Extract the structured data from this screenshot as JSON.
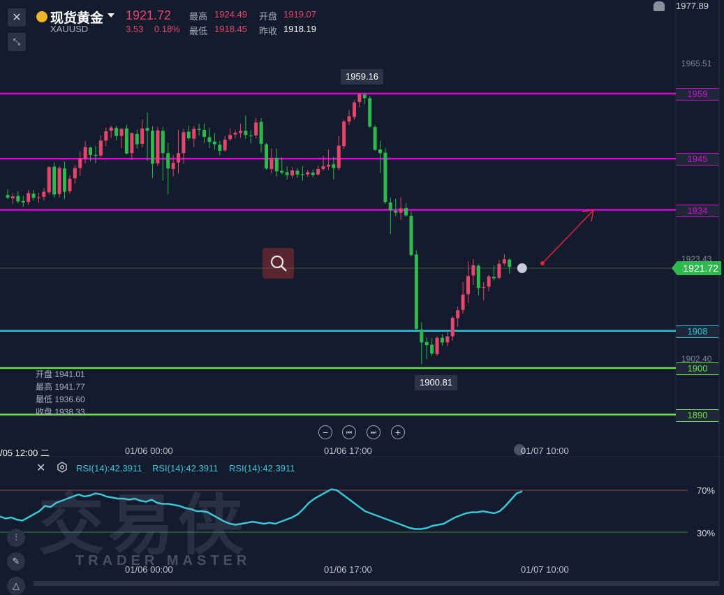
{
  "header": {
    "symbol_name": "现货黄金",
    "symbol_code": "XAUUSD",
    "last_price": "1921.72",
    "change": "3.53",
    "change_pct": "0.18%",
    "high_label": "最高",
    "high_value": "1924.49",
    "open_label": "开盘",
    "open_value": "1919.07",
    "low_label": "最低",
    "low_value": "1918.45",
    "prev_close_label": "昨收",
    "prev_close_value": "1918.19"
  },
  "price_axis": {
    "top_value": "1977.89",
    "max_value": "1965.51",
    "current_marker": "1923.43",
    "current_price": "1921.72",
    "min_value": "1902.40"
  },
  "levels": [
    {
      "label": "1959",
      "price": 1959,
      "color": "#d10fd1"
    },
    {
      "label": "1945",
      "price": 1945,
      "color": "#d10fd1"
    },
    {
      "label": "1934",
      "price": 1934,
      "color": "#d10fd1"
    },
    {
      "label": "1908",
      "price": 1908,
      "color": "#26c6d6"
    },
    {
      "label": "1900",
      "price": 1900,
      "color": "#6be04a"
    },
    {
      "label": "1890",
      "price": 1890,
      "color": "#6be04a"
    }
  ],
  "callouts": {
    "high": "1959.16",
    "low": "1900.81"
  },
  "ohlc_panel": {
    "open": "开盘 1941.01",
    "high": "最高 1941.77",
    "low": "最低 1936.60",
    "close": "收盘 1938.33"
  },
  "time_axis": {
    "labels": [
      "/05 12:00 二",
      "01/06 00:00",
      "01/06 17:00",
      "01/07 10:00"
    ]
  },
  "rsi": {
    "labels": [
      "RSI(14):42.3911",
      "RSI(14):42.3911",
      "RSI(14):42.3911"
    ],
    "upper": "70%",
    "lower": "30%",
    "time_labels": [
      "01/06 00:00",
      "01/06 17:00",
      "01/07 10:00"
    ]
  },
  "watermark": {
    "cn": "交易侠",
    "en": "TRADER MASTER"
  },
  "colors": {
    "up": "#e8456d",
    "down": "#2fb84e",
    "rsi_line": "#35c8d8",
    "arrow": "#e0243a"
  },
  "chart_data": {
    "type": "candlestick",
    "symbol": "XAUUSD",
    "y_range": [
      1890,
      1965.51
    ],
    "candles": [
      {
        "o": 1937.2,
        "h": 1938.4,
        "l": 1936.3,
        "c": 1936.6
      },
      {
        "o": 1936.5,
        "h": 1937.6,
        "l": 1935.2,
        "c": 1936.9
      },
      {
        "o": 1937.0,
        "h": 1938.0,
        "l": 1935.4,
        "c": 1935.8
      },
      {
        "o": 1935.9,
        "h": 1937.0,
        "l": 1934.7,
        "c": 1935.6
      },
      {
        "o": 1935.7,
        "h": 1938.3,
        "l": 1935.1,
        "c": 1937.6
      },
      {
        "o": 1937.5,
        "h": 1938.3,
        "l": 1936.0,
        "c": 1936.6
      },
      {
        "o": 1936.6,
        "h": 1937.7,
        "l": 1935.5,
        "c": 1936.7
      },
      {
        "o": 1936.8,
        "h": 1938.7,
        "l": 1936.0,
        "c": 1937.9
      },
      {
        "o": 1937.8,
        "h": 1943.4,
        "l": 1937.4,
        "c": 1943.2
      },
      {
        "o": 1943.3,
        "h": 1944.2,
        "l": 1936.6,
        "c": 1937.3
      },
      {
        "o": 1937.4,
        "h": 1943.4,
        "l": 1936.7,
        "c": 1943.0
      },
      {
        "o": 1942.9,
        "h": 1944.4,
        "l": 1936.3,
        "c": 1937.9
      },
      {
        "o": 1938.0,
        "h": 1941.4,
        "l": 1937.5,
        "c": 1940.7
      },
      {
        "o": 1940.8,
        "h": 1943.7,
        "l": 1939.6,
        "c": 1943.0
      },
      {
        "o": 1943.0,
        "h": 1946.6,
        "l": 1941.3,
        "c": 1945.1
      },
      {
        "o": 1945.0,
        "h": 1948.8,
        "l": 1944.0,
        "c": 1947.5
      },
      {
        "o": 1947.4,
        "h": 1947.6,
        "l": 1944.5,
        "c": 1945.8
      },
      {
        "o": 1945.8,
        "h": 1947.7,
        "l": 1944.0,
        "c": 1945.6
      },
      {
        "o": 1945.7,
        "h": 1950.0,
        "l": 1945.3,
        "c": 1948.9
      },
      {
        "o": 1948.9,
        "h": 1951.7,
        "l": 1947.7,
        "c": 1950.9
      },
      {
        "o": 1951.0,
        "h": 1952.1,
        "l": 1949.5,
        "c": 1951.7
      },
      {
        "o": 1951.6,
        "h": 1952.1,
        "l": 1949.0,
        "c": 1949.9
      },
      {
        "o": 1949.9,
        "h": 1951.6,
        "l": 1947.3,
        "c": 1951.4
      },
      {
        "o": 1951.5,
        "h": 1952.3,
        "l": 1945.9,
        "c": 1946.1
      },
      {
        "o": 1946.2,
        "h": 1950.6,
        "l": 1944.8,
        "c": 1950.5
      },
      {
        "o": 1950.3,
        "h": 1951.2,
        "l": 1947.2,
        "c": 1948.1
      },
      {
        "o": 1948.2,
        "h": 1953.4,
        "l": 1947.4,
        "c": 1951.5
      },
      {
        "o": 1951.6,
        "h": 1955.0,
        "l": 1944.5,
        "c": 1951.0
      },
      {
        "o": 1951.0,
        "h": 1952.0,
        "l": 1940.9,
        "c": 1943.9
      },
      {
        "o": 1944.0,
        "h": 1951.9,
        "l": 1943.4,
        "c": 1951.1
      },
      {
        "o": 1951.0,
        "h": 1951.9,
        "l": 1940.3,
        "c": 1946.2
      },
      {
        "o": 1946.2,
        "h": 1948.4,
        "l": 1937.3,
        "c": 1942.9
      },
      {
        "o": 1942.8,
        "h": 1945.8,
        "l": 1941.2,
        "c": 1944.1
      },
      {
        "o": 1944.2,
        "h": 1951.2,
        "l": 1941.8,
        "c": 1946.2
      },
      {
        "o": 1946.2,
        "h": 1951.4,
        "l": 1943.9,
        "c": 1950.7
      },
      {
        "o": 1950.8,
        "h": 1952.1,
        "l": 1949.0,
        "c": 1949.4
      },
      {
        "o": 1949.3,
        "h": 1952.0,
        "l": 1947.5,
        "c": 1951.4
      },
      {
        "o": 1951.4,
        "h": 1952.5,
        "l": 1950.0,
        "c": 1951.2
      },
      {
        "o": 1951.2,
        "h": 1952.6,
        "l": 1948.4,
        "c": 1949.7
      },
      {
        "o": 1949.6,
        "h": 1951.6,
        "l": 1947.3,
        "c": 1948.6
      },
      {
        "o": 1948.7,
        "h": 1950.5,
        "l": 1946.9,
        "c": 1948.1
      },
      {
        "o": 1948.0,
        "h": 1948.8,
        "l": 1945.7,
        "c": 1946.7
      },
      {
        "o": 1946.8,
        "h": 1949.9,
        "l": 1946.5,
        "c": 1949.1
      },
      {
        "o": 1949.2,
        "h": 1951.5,
        "l": 1948.8,
        "c": 1950.1
      },
      {
        "o": 1950.2,
        "h": 1951.1,
        "l": 1949.4,
        "c": 1950.6
      },
      {
        "o": 1950.5,
        "h": 1952.5,
        "l": 1949.5,
        "c": 1951.0
      },
      {
        "o": 1951.0,
        "h": 1954.3,
        "l": 1949.3,
        "c": 1950.1
      },
      {
        "o": 1950.0,
        "h": 1951.1,
        "l": 1948.3,
        "c": 1949.9
      },
      {
        "o": 1950.0,
        "h": 1953.8,
        "l": 1949.4,
        "c": 1952.8
      },
      {
        "o": 1952.9,
        "h": 1953.7,
        "l": 1946.3,
        "c": 1948.2
      },
      {
        "o": 1948.1,
        "h": 1948.4,
        "l": 1942.6,
        "c": 1942.9
      },
      {
        "o": 1942.8,
        "h": 1947.2,
        "l": 1941.8,
        "c": 1945.2
      },
      {
        "o": 1945.2,
        "h": 1947.2,
        "l": 1941.2,
        "c": 1942.3
      },
      {
        "o": 1942.4,
        "h": 1945.3,
        "l": 1941.6,
        "c": 1942.0
      },
      {
        "o": 1942.1,
        "h": 1943.4,
        "l": 1940.5,
        "c": 1941.5
      },
      {
        "o": 1941.4,
        "h": 1943.2,
        "l": 1940.8,
        "c": 1942.5
      },
      {
        "o": 1942.4,
        "h": 1943.0,
        "l": 1940.9,
        "c": 1941.6
      },
      {
        "o": 1941.7,
        "h": 1943.4,
        "l": 1940.3,
        "c": 1941.5
      },
      {
        "o": 1941.6,
        "h": 1942.6,
        "l": 1941.1,
        "c": 1942.1
      },
      {
        "o": 1942.0,
        "h": 1942.7,
        "l": 1941.0,
        "c": 1941.5
      },
      {
        "o": 1941.6,
        "h": 1943.5,
        "l": 1941.3,
        "c": 1942.8
      },
      {
        "o": 1942.8,
        "h": 1945.6,
        "l": 1942.4,
        "c": 1943.4
      },
      {
        "o": 1943.3,
        "h": 1947.0,
        "l": 1942.6,
        "c": 1943.7
      },
      {
        "o": 1943.8,
        "h": 1945.4,
        "l": 1940.5,
        "c": 1943.0
      },
      {
        "o": 1943.0,
        "h": 1949.9,
        "l": 1942.5,
        "c": 1947.8
      },
      {
        "o": 1947.7,
        "h": 1953.4,
        "l": 1947.1,
        "c": 1953.0
      },
      {
        "o": 1953.0,
        "h": 1955.5,
        "l": 1952.2,
        "c": 1954.1
      },
      {
        "o": 1954.0,
        "h": 1957.6,
        "l": 1953.4,
        "c": 1957.1
      },
      {
        "o": 1957.2,
        "h": 1959.16,
        "l": 1956.0,
        "c": 1958.9
      },
      {
        "o": 1958.8,
        "h": 1959.1,
        "l": 1956.7,
        "c": 1958.0
      },
      {
        "o": 1958.0,
        "h": 1958.5,
        "l": 1951.6,
        "c": 1951.9
      },
      {
        "o": 1951.8,
        "h": 1952.2,
        "l": 1946.7,
        "c": 1946.9
      },
      {
        "o": 1947.0,
        "h": 1948.8,
        "l": 1941.9,
        "c": 1946.2
      },
      {
        "o": 1946.3,
        "h": 1947.3,
        "l": 1935.3,
        "c": 1935.7
      },
      {
        "o": 1935.6,
        "h": 1936.6,
        "l": 1928.8,
        "c": 1933.9
      },
      {
        "o": 1933.8,
        "h": 1936.4,
        "l": 1932.7,
        "c": 1933.4
      },
      {
        "o": 1933.4,
        "h": 1936.7,
        "l": 1931.8,
        "c": 1934.3
      },
      {
        "o": 1934.4,
        "h": 1935.4,
        "l": 1932.5,
        "c": 1932.8
      },
      {
        "o": 1932.7,
        "h": 1933.6,
        "l": 1924.0,
        "c": 1924.3
      },
      {
        "o": 1924.4,
        "h": 1925.3,
        "l": 1908.2,
        "c": 1908.4
      },
      {
        "o": 1908.3,
        "h": 1909.9,
        "l": 1900.81,
        "c": 1905.5
      },
      {
        "o": 1905.6,
        "h": 1906.6,
        "l": 1901.9,
        "c": 1904.9
      },
      {
        "o": 1905.0,
        "h": 1906.4,
        "l": 1902.6,
        "c": 1903.1
      },
      {
        "o": 1903.0,
        "h": 1906.8,
        "l": 1902.6,
        "c": 1906.5
      },
      {
        "o": 1906.5,
        "h": 1907.3,
        "l": 1904.8,
        "c": 1905.5
      },
      {
        "o": 1905.5,
        "h": 1907.8,
        "l": 1904.7,
        "c": 1906.8
      },
      {
        "o": 1906.8,
        "h": 1911.2,
        "l": 1905.9,
        "c": 1910.8
      },
      {
        "o": 1910.7,
        "h": 1913.2,
        "l": 1908.9,
        "c": 1912.4
      },
      {
        "o": 1912.5,
        "h": 1918.5,
        "l": 1911.7,
        "c": 1915.8
      },
      {
        "o": 1915.9,
        "h": 1922.9,
        "l": 1914.0,
        "c": 1919.8
      },
      {
        "o": 1919.9,
        "h": 1923.4,
        "l": 1917.9,
        "c": 1922.1
      },
      {
        "o": 1922.0,
        "h": 1922.4,
        "l": 1915.6,
        "c": 1917.2
      },
      {
        "o": 1917.3,
        "h": 1918.5,
        "l": 1914.6,
        "c": 1917.4
      },
      {
        "o": 1917.5,
        "h": 1920.0,
        "l": 1916.5,
        "c": 1919.7
      },
      {
        "o": 1919.6,
        "h": 1922.1,
        "l": 1918.8,
        "c": 1919.3
      },
      {
        "o": 1919.4,
        "h": 1923.2,
        "l": 1919.1,
        "c": 1922.4
      },
      {
        "o": 1922.5,
        "h": 1924.5,
        "l": 1922.0,
        "c": 1923.4
      },
      {
        "o": 1923.3,
        "h": 1923.6,
        "l": 1920.3,
        "c": 1921.72
      }
    ],
    "rsi_series": [
      45,
      43,
      44,
      42,
      41,
      44,
      47,
      50,
      55,
      54,
      58,
      60,
      62,
      64,
      66,
      64,
      65,
      67,
      66,
      64,
      63,
      62,
      62,
      61,
      62,
      60,
      59,
      61,
      58,
      57,
      57,
      56,
      55,
      53,
      52,
      50,
      50,
      49,
      46,
      43,
      40,
      38,
      37,
      38,
      39,
      40,
      39,
      38,
      39,
      38,
      40,
      42,
      44,
      47,
      52,
      58,
      62,
      65,
      68,
      71,
      70,
      66,
      62,
      58,
      54,
      50,
      48,
      46,
      44,
      42,
      40,
      38,
      36,
      34,
      33,
      33,
      34,
      36,
      37,
      38,
      41,
      44,
      46,
      48,
      49,
      49,
      50,
      49,
      48,
      50,
      55,
      61,
      67,
      69
    ]
  }
}
